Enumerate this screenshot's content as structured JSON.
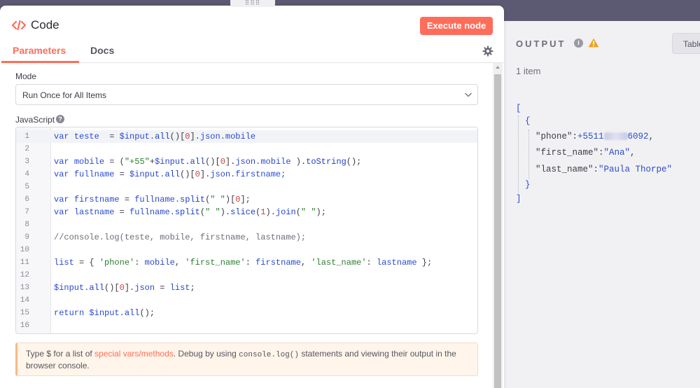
{
  "node": {
    "title": "Code",
    "execute_label": "Execute node"
  },
  "tabs": [
    {
      "label": "Parameters",
      "active": true
    },
    {
      "label": "Docs",
      "active": false
    }
  ],
  "params": {
    "mode_label": "Mode",
    "mode_value": "Run Once for All Items",
    "js_label": "JavaScript",
    "help_glyph": "?"
  },
  "code_lines": [
    {
      "n": "1"
    },
    {
      "n": "2"
    },
    {
      "n": "3"
    },
    {
      "n": "4"
    },
    {
      "n": "5"
    },
    {
      "n": "6"
    },
    {
      "n": "7"
    },
    {
      "n": "8"
    },
    {
      "n": "9"
    },
    {
      "n": "10"
    },
    {
      "n": "11"
    },
    {
      "n": "12"
    },
    {
      "n": "13"
    },
    {
      "n": "14"
    },
    {
      "n": "15"
    },
    {
      "n": "16"
    }
  ],
  "code_tokens": {
    "l1": [
      "var",
      "teste",
      "=",
      "$input.",
      "all",
      "()[",
      "0",
      "].",
      "json",
      ".mobile"
    ],
    "l3": [
      "var",
      "mobile",
      "= (",
      "\"+55\"",
      "+",
      "$input.",
      "all",
      "()[",
      "0",
      "].",
      "json",
      ".mobile",
      " ).",
      "toString",
      "();"
    ],
    "l4": [
      "var",
      "fullname",
      "=",
      "$input.",
      "all",
      "()[",
      "0",
      "].",
      "json",
      ".firstname;"
    ],
    "l6": [
      "var",
      "firstname",
      "=",
      "fullname.",
      "split",
      "(",
      "\" \"",
      ")[",
      "0",
      "];"
    ],
    "l7": [
      "var",
      "lastname",
      "=",
      "fullname.",
      "split",
      "(",
      "\" \"",
      ").",
      "slice",
      "(",
      "1",
      ").",
      "join",
      "(",
      "\" \"",
      ");"
    ],
    "l9": [
      "//console.log(teste, mobile, firstname, lastname);"
    ],
    "l11": [
      "list",
      "= { ",
      "'phone'",
      ": ",
      "mobile",
      ", ",
      "'first_name'",
      ": ",
      "firstname",
      ", ",
      "'last_name'",
      ": ",
      "lastname",
      " };"
    ],
    "l13": [
      "$input.",
      "all",
      "()[",
      "0",
      "].",
      "json",
      " = ",
      "list",
      ";"
    ],
    "l15": [
      "return",
      "$input.",
      "all",
      "();"
    ]
  },
  "hint": {
    "prefix": "Type $ for a list of ",
    "link": "special vars/methods",
    "middle": ". Debug by using ",
    "code": "console.log()",
    "suffix": " statements and viewing their output in the browser console."
  },
  "output": {
    "title": "OUTPUT",
    "info_glyph": "i",
    "table_label": "Table",
    "item_count": "1 item",
    "open_bracket": "[",
    "open_brace": "{",
    "close_brace": "}",
    "close_bracket": "]",
    "fields": [
      {
        "key": "\"phone\"",
        "value_prefix": "+5511",
        "value_suffix": "6092",
        "redacted": true
      },
      {
        "key": "\"first_name\"",
        "value": "\"Ana\""
      },
      {
        "key": "\"last_name\"",
        "value": "\"Paula Thorpe\""
      }
    ]
  },
  "colors": {
    "accent": "#ff6d5a",
    "keyword": "#2b4ad0",
    "string": "#2e7d32",
    "number": "#d23f3f",
    "warning": "#f0a020"
  },
  "icons": {
    "code": "code-icon",
    "settings": "gear-icon",
    "dropdown": "chevron-down-icon",
    "help": "help-icon",
    "info": "info-icon",
    "warning": "warning-icon"
  }
}
